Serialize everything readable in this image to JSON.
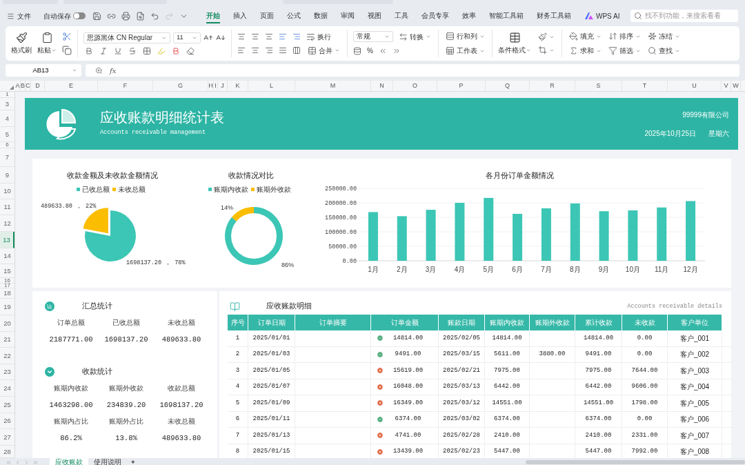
{
  "menu": {
    "file": "文件",
    "autosave": {
      "label": "自动保存",
      "on": false
    },
    "tabs": [
      {
        "label": "开始",
        "selected": true
      },
      {
        "label": "插入",
        "selected": false
      },
      {
        "label": "页面",
        "selected": false
      },
      {
        "label": "公式",
        "selected": false
      },
      {
        "label": "数据",
        "selected": false
      },
      {
        "label": "审阅",
        "selected": false
      },
      {
        "label": "视图",
        "selected": false
      },
      {
        "label": "工具",
        "selected": false
      },
      {
        "label": "会员专享",
        "selected": false
      },
      {
        "label": "效率",
        "selected": false
      },
      {
        "label": "智能工具箱",
        "selected": false
      },
      {
        "label": "财务工具箱",
        "selected": false
      }
    ],
    "ai": "WPS AI",
    "search": {
      "placeholder": "找不到功能，来搜索看看"
    }
  },
  "ribbon": {
    "format_painter": "格式刷",
    "paste": "粘贴",
    "font": "思源黑体 CN Regular",
    "size": "11",
    "wrap": "换行",
    "merge": "合并",
    "number_format": "常规",
    "convert": "转换",
    "percent": "%",
    "rows_cols": "行和列",
    "sheet": "工作表",
    "cond_format": "条件格式",
    "fill": "填充",
    "sort": "排序",
    "freeze": "冻结",
    "sum": "求和",
    "filter": "筛选",
    "find": "查找"
  },
  "formula_bar": {
    "cell": "AB13",
    "fx": "fx"
  },
  "columns": [
    "A",
    "B",
    "C",
    "D",
    "E",
    "F",
    "G",
    "H",
    "I",
    "J",
    "K",
    "L",
    "M",
    "N",
    "O",
    "P",
    "Q",
    "R",
    "S",
    "T",
    "U",
    "V",
    "W"
  ],
  "rows": [
    {
      "label": "1",
      "selected": false
    },
    {
      "label": "3",
      "selected": false
    },
    {
      "label": "4",
      "selected": false
    },
    {
      "label": "5",
      "selected": false
    },
    {
      "label": "6",
      "selected": false
    },
    {
      "label": "7",
      "selected": false
    },
    {
      "label": "9",
      "selected": false
    },
    {
      "label": "10",
      "selected": false
    },
    {
      "label": "11",
      "selected": false
    },
    {
      "label": "12",
      "selected": false
    },
    {
      "label": "13",
      "selected": true
    },
    {
      "label": "14",
      "selected": false
    },
    {
      "label": "15",
      "selected": false
    },
    {
      "label": "16",
      "selected": false
    },
    {
      "label": "17",
      "selected": false
    },
    {
      "label": "18",
      "selected": false
    },
    {
      "label": "19",
      "selected": false
    },
    {
      "label": "20",
      "selected": false
    },
    {
      "label": "21",
      "selected": false
    },
    {
      "label": "22",
      "selected": false
    },
    {
      "label": "23",
      "selected": false
    },
    {
      "label": "24",
      "selected": false
    },
    {
      "label": "25",
      "selected": false
    },
    {
      "label": "26",
      "selected": false
    },
    {
      "label": "27",
      "selected": false
    },
    {
      "label": "28",
      "selected": false
    }
  ],
  "banner": {
    "title": "应收账款明细统计表",
    "subtitle": "Accounts receivable management",
    "company": "99999有限公司",
    "date": "2025年10月25日",
    "weekday": "星期六"
  },
  "charts": [
    {
      "chart_data": {
        "type": "pie",
        "title": "收款金额及未收款金额情况",
        "legend": true,
        "categories": [
          "已收总额",
          "未收总额"
        ],
        "colors": [
          "#3cc6b5",
          "#fbbd00"
        ],
        "values": [
          78,
          22
        ],
        "value_labels": [
          "1698137.20 ， 78%",
          "489633.80 ， 22%"
        ]
      }
    },
    {
      "chart_data": {
        "type": "donut",
        "title": "收款情况对比",
        "legend": true,
        "categories": [
          "账期内收款",
          "账期外收款"
        ],
        "colors": [
          "#3cc6b5",
          "#fbbd00"
        ],
        "values": [
          86.2,
          13.8
        ],
        "value_labels": [
          "86%",
          "14%"
        ]
      }
    },
    {
      "chart_data": {
        "type": "bar",
        "title": "各月份订单金额情况",
        "grid": true,
        "categories": [
          "1月",
          "2月",
          "3月",
          "4月",
          "5月",
          "6月",
          "7月",
          "8月",
          "9月",
          "10月",
          "11月",
          "12月"
        ],
        "series": [
          {
            "color": "#3cc6b5",
            "values": [
              168000,
              154000,
              176000,
              200000,
              217000,
              162000,
              181000,
              198000,
              171000,
              174000,
              184000,
              206000
            ]
          }
        ],
        "ylim": [
          0,
          250000
        ],
        "yticks": [
          {
            "value": 0,
            "label": "0.00"
          },
          {
            "value": 50000,
            "label": "50000.00"
          },
          {
            "value": 100000,
            "label": "100000.00"
          },
          {
            "value": 150000,
            "label": "150000.00"
          },
          {
            "value": 200000,
            "label": "200000.00"
          },
          {
            "value": 250000,
            "label": "250000.00"
          }
        ]
      }
    }
  ],
  "summary": {
    "title": "汇总统计",
    "items": [
      {
        "label": "订单总额",
        "value": "2187771.00"
      },
      {
        "label": "已收总额",
        "value": "1698137.20"
      },
      {
        "label": "未收总额",
        "value": "489633.80"
      }
    ]
  },
  "collection": {
    "title": "收款统计",
    "items": [
      {
        "label": "账期内收款",
        "value": "1463298.00"
      },
      {
        "label": "账期外收款",
        "value": "234839.20"
      },
      {
        "label": "收款总额",
        "value": "1698137.20"
      },
      {
        "label": "账期内占比",
        "value": "86.2%"
      },
      {
        "label": "账期外占比",
        "value": "13.8%"
      },
      {
        "label": "未收总额",
        "value": "489633.80"
      }
    ]
  },
  "details": {
    "title": "应收账款明细",
    "subtitle": "Accounts receivable details",
    "columns": [
      "序号",
      "订单日期",
      "订单摘要",
      "订单金额",
      "账款日期",
      "账期内收款",
      "账期外收款",
      "累计收款",
      "未收款",
      "客户单位"
    ],
    "rows": [
      {
        "no": "1",
        "order_date": "2025/01/01",
        "paid": true,
        "amount": "14814.00",
        "due_date": "2025/02/05",
        "in_term": "14814.00",
        "total": "14814.00",
        "unpaid": "0.00",
        "customer": "客户_001"
      },
      {
        "no": "2",
        "order_date": "2025/01/03",
        "paid": true,
        "amount": "9491.00",
        "due_date": "2025/03/15",
        "in_term": "5611.00",
        "out_term": "3880.00",
        "total": "9491.00",
        "unpaid": "0.00",
        "customer": "客户_002"
      },
      {
        "no": "3",
        "order_date": "2025/01/05",
        "paid": false,
        "amount": "15619.00",
        "due_date": "2025/02/21",
        "in_term": "7975.00",
        "total": "7975.00",
        "unpaid": "7644.00",
        "customer": "客户_003"
      },
      {
        "no": "4",
        "order_date": "2025/01/07",
        "paid": false,
        "amount": "16048.00",
        "due_date": "2025/03/13",
        "in_term": "6442.00",
        "total": "6442.00",
        "unpaid": "9606.00",
        "customer": "客户_004"
      },
      {
        "no": "5",
        "order_date": "2025/01/09",
        "paid": false,
        "amount": "16349.00",
        "due_date": "2025/03/12",
        "in_term": "14551.00",
        "total": "14551.00",
        "unpaid": "1798.00",
        "customer": "客户_005"
      },
      {
        "no": "6",
        "order_date": "2025/01/11",
        "paid": true,
        "amount": "6374.00",
        "due_date": "2025/03/02",
        "in_term": "6374.00",
        "total": "6374.00",
        "unpaid": "0.00",
        "customer": "客户_006"
      },
      {
        "no": "7",
        "order_date": "2025/01/13",
        "paid": false,
        "amount": "4741.00",
        "due_date": "2025/02/28",
        "in_term": "2410.00",
        "total": "2410.00",
        "unpaid": "2331.00",
        "customer": "客户_007"
      },
      {
        "no": "8",
        "order_date": "2025/01/15",
        "paid": false,
        "amount": "13439.00",
        "due_date": "2025/02/23",
        "in_term": "5447.00",
        "total": "5447.00",
        "unpaid": "7992.00",
        "customer": "客户_008"
      }
    ]
  },
  "sheet_tabs": [
    {
      "label": "应收账款",
      "selected": true
    },
    {
      "label": "使用说明",
      "selected": false
    }
  ],
  "add_sheet": "+"
}
